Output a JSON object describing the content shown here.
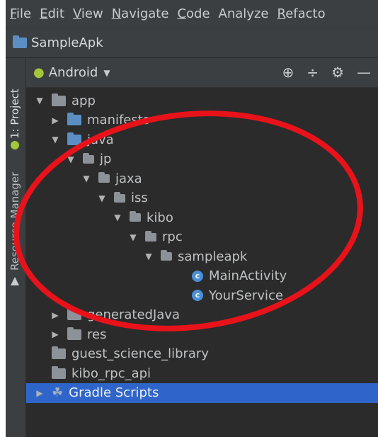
{
  "menubar": {
    "items": [
      {
        "mnemonic": "F",
        "rest": "ile"
      },
      {
        "mnemonic": "E",
        "rest": "dit"
      },
      {
        "mnemonic": "V",
        "rest": "iew"
      },
      {
        "mnemonic": "N",
        "rest": "avigate"
      },
      {
        "mnemonic": "C",
        "rest": "ode"
      },
      {
        "mnemonic": "",
        "rest": "Analyze"
      },
      {
        "mnemonic": "R",
        "rest": "efacto"
      }
    ]
  },
  "project": {
    "name": "SampleApk"
  },
  "sidebar": {
    "project_tab": "1: Project",
    "resource_tab": "Resource Manager"
  },
  "toolbar": {
    "view": "Android"
  },
  "tree": [
    {
      "label": "app",
      "arrow": "down",
      "icon": "module-folder",
      "selected": false
    },
    {
      "label": "manifests",
      "arrow": "right",
      "icon": "folder",
      "selected": false
    },
    {
      "label": "java",
      "arrow": "down",
      "icon": "folder",
      "selected": false
    },
    {
      "label": "jp",
      "arrow": "down",
      "icon": "package",
      "selected": false
    },
    {
      "label": "jaxa",
      "arrow": "down",
      "icon": "package",
      "selected": false
    },
    {
      "label": "iss",
      "arrow": "down",
      "icon": "package",
      "selected": false
    },
    {
      "label": "kibo",
      "arrow": "down",
      "icon": "package",
      "selected": false
    },
    {
      "label": "rpc",
      "arrow": "down",
      "icon": "package",
      "selected": false
    },
    {
      "label": "sampleapk",
      "arrow": "down",
      "icon": "package",
      "selected": false
    },
    {
      "label": "MainActivity",
      "arrow": "",
      "icon": "class",
      "selected": false
    },
    {
      "label": "YourService",
      "arrow": "",
      "icon": "class",
      "selected": false
    },
    {
      "label": "generatedJava",
      "arrow": "right",
      "icon": "generated-folder",
      "selected": false
    },
    {
      "label": "res",
      "arrow": "right",
      "icon": "res-folder",
      "selected": false
    },
    {
      "label": "guest_science_library",
      "arrow": "",
      "icon": "module-folder",
      "selected": false
    },
    {
      "label": "kibo_rpc_api",
      "arrow": "",
      "icon": "module-folder",
      "selected": false
    },
    {
      "label": "Gradle Scripts",
      "arrow": "right",
      "icon": "gradle",
      "selected": true
    }
  ],
  "colors": {
    "annotation": "#e8131a",
    "selection": "#2f65ca",
    "folder": "#5b8fc4"
  }
}
